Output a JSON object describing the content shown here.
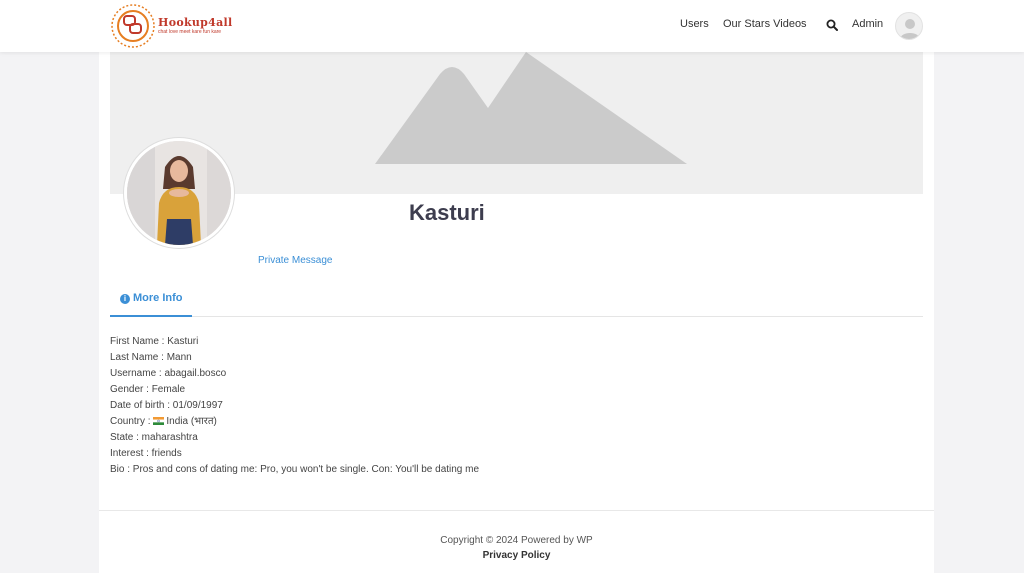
{
  "header": {
    "logo_text": "Hookup4all",
    "logo_tagline": "chat love meet kare fun kare",
    "nav": {
      "users": "Users",
      "stars": "Our Stars Videos",
      "admin": "Admin"
    }
  },
  "profile": {
    "name": "Kasturi",
    "private_message": "Private Message"
  },
  "tabs": {
    "more_info": "More Info"
  },
  "info": [
    "First Name : Kasturi",
    "Last Name : Mann",
    "Username : abagail.bosco",
    "Gender : Female",
    "Date of birth : 01/09/1997",
    "Country : ",
    "State : maharashtra",
    "Interest : friends",
    "Bio : Pros and cons of dating me: Pro, you won't be single. Con: You'll be dating me"
  ],
  "country_value": "India (भारत)",
  "footer": {
    "copyright": "Copyright © 2024 Powered by WP",
    "privacy": "Privacy Policy"
  },
  "colors": {
    "accent": "#3b8fd6",
    "brand": "#c0392b"
  }
}
